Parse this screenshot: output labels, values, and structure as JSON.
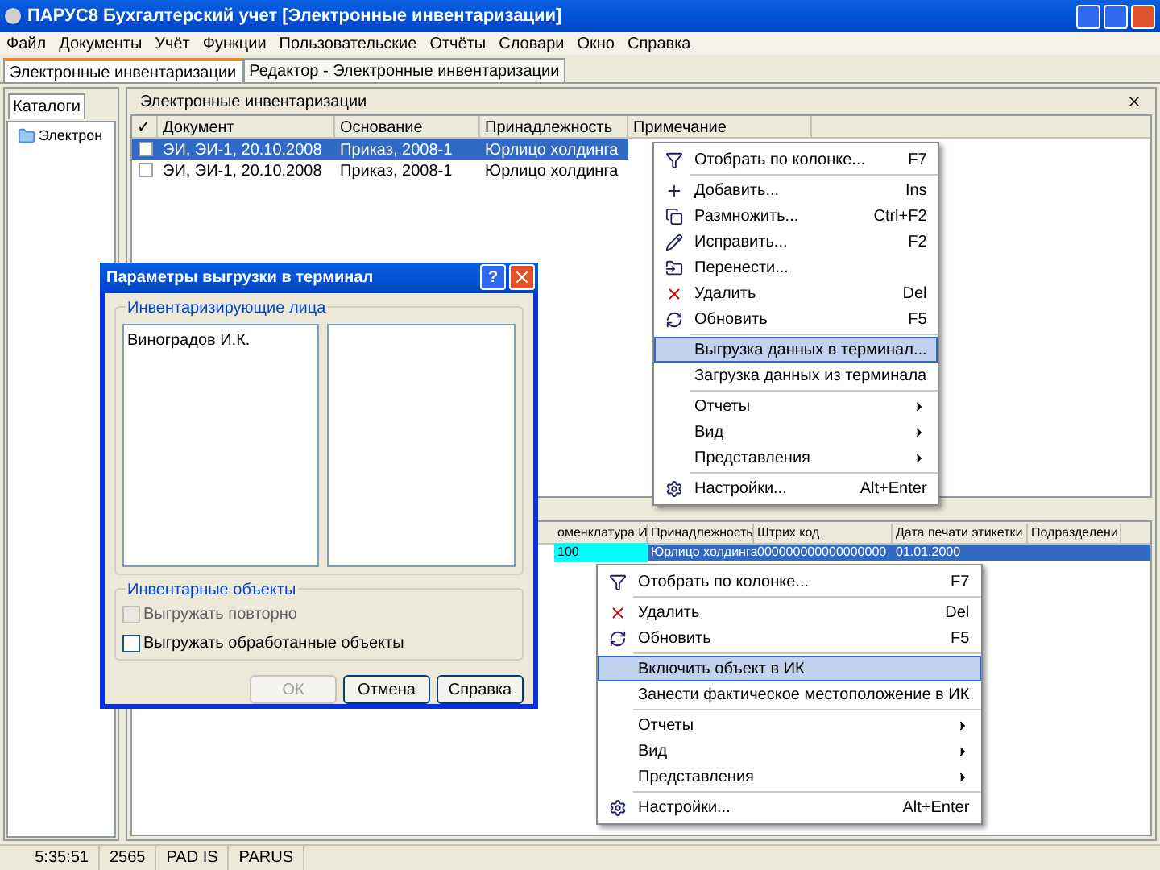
{
  "window": {
    "title": "ПАРУС8 Бухгалтерский учет  [Электронные инвентаризации]"
  },
  "menu_bar": [
    "Файл",
    "Документы",
    "Учёт",
    "Функции",
    "Пользовательские",
    "Отчёты",
    "Словари",
    "Окно",
    "Справка"
  ],
  "document_tabs": [
    {
      "label": "Электронные инвентаризации",
      "selected": true
    },
    {
      "label": "Редактор - Электронные инвентаризации",
      "selected": false
    }
  ],
  "left_panel": {
    "tab": "Каталоги",
    "tree": [
      {
        "label": "Электрон",
        "selected": false
      }
    ]
  },
  "panel_title": "Электронные инвентаризации",
  "top_table": {
    "check_header": "✓",
    "columns": [
      "Документ",
      "Основание",
      "Принадлежность",
      "Примечание"
    ],
    "rows": [
      {
        "selected": true,
        "checked": false,
        "cells": [
          "ЭИ, ЭИ-1, 20.10.2008",
          "Приказ, 2008-1",
          "Юрлицо холдинга"
        ]
      },
      {
        "selected": false,
        "checked": false,
        "cells": [
          "ЭИ, ЭИ-1, 20.10.2008",
          "Приказ, 2008-1",
          "Юрлицо холдинга"
        ]
      }
    ]
  },
  "bottom_table": {
    "columns": [
      "оменклатура И",
      "Принадлежность",
      "Штрих код",
      "Дата печати этикетки",
      "Подразделени"
    ],
    "rows": [
      {
        "selected": true,
        "cells": [
          "100",
          "Юрлицо холдинга",
          "000000000000000000",
          "01.01.2000"
        ]
      }
    ]
  },
  "context_menu_1": {
    "groups": [
      [
        {
          "kind": "filter",
          "label": "Отобрать по колонке...",
          "shortcut": "F7",
          "selected": false
        }
      ],
      [
        {
          "kind": "plus",
          "label": "Добавить...",
          "shortcut": "Ins",
          "selected": false
        },
        {
          "kind": "copy",
          "label": "Размножить...",
          "shortcut": "Ctrl+F2",
          "selected": false
        },
        {
          "kind": "edit",
          "label": "Исправить...",
          "shortcut": "F2",
          "selected": false
        },
        {
          "kind": "move",
          "label": "Перенести...",
          "selected": false
        },
        {
          "kind": "delete",
          "label": "Удалить",
          "shortcut": "Del",
          "selected": false
        },
        {
          "kind": "refresh",
          "label": "Обновить",
          "shortcut": "F5",
          "selected": false
        }
      ],
      [
        {
          "kind": "plain",
          "label": "Выгрузка данных в терминал...",
          "selected": true
        },
        {
          "kind": "plain",
          "label": "Загрузка данных из терминала",
          "selected": false
        }
      ],
      [
        {
          "kind": "submenu",
          "label": "Отчеты",
          "selected": false
        },
        {
          "kind": "submenu",
          "label": "Вид",
          "selected": false
        },
        {
          "kind": "submenu",
          "label": "Представления",
          "selected": false
        }
      ],
      [
        {
          "kind": "settings",
          "label": "Настройки...",
          "shortcut": "Alt+Enter",
          "selected": false
        }
      ]
    ]
  },
  "context_menu_2": {
    "groups": [
      [
        {
          "kind": "filter",
          "label": "Отобрать по колонке...",
          "shortcut": "F7",
          "selected": false
        }
      ],
      [
        {
          "kind": "delete",
          "label": "Удалить",
          "shortcut": "Del",
          "selected": false
        },
        {
          "kind": "refresh",
          "label": "Обновить",
          "shortcut": "F5",
          "selected": false
        }
      ],
      [
        {
          "kind": "plain",
          "label": "Включить объект в ИК",
          "selected": true
        },
        {
          "kind": "plain",
          "label": "Занести фактическое местоположение в ИК",
          "selected": false
        }
      ],
      [
        {
          "kind": "submenu",
          "label": "Отчеты",
          "selected": false
        },
        {
          "kind": "submenu",
          "label": "Вид",
          "selected": false
        },
        {
          "kind": "submenu",
          "label": "Представления",
          "selected": false
        }
      ],
      [
        {
          "kind": "settings",
          "label": "Настройки...",
          "shortcut": "Alt+Enter",
          "selected": false
        }
      ]
    ]
  },
  "dialog": {
    "title": "Параметры выгрузки в терминал",
    "help_button": "?",
    "persons_group": {
      "title": "Инвентаризирующие лица",
      "left_list": [
        "Виноградов И.К."
      ]
    },
    "objects_group": {
      "title": "Инвентарные объекты",
      "options": [
        {
          "label": "Выгружать повторно",
          "checked": false,
          "disabled": true
        },
        {
          "label": "Выгружать обработанные объекты",
          "checked": false,
          "disabled": false
        }
      ]
    },
    "buttons": [
      {
        "label": "ОК",
        "disabled": true
      },
      {
        "label": "Отмена",
        "disabled": false
      },
      {
        "label": "Справка",
        "disabled": false
      }
    ]
  },
  "status_bar": [
    "5:35:51",
    "2565",
    "PAD IS",
    "PARUS"
  ]
}
